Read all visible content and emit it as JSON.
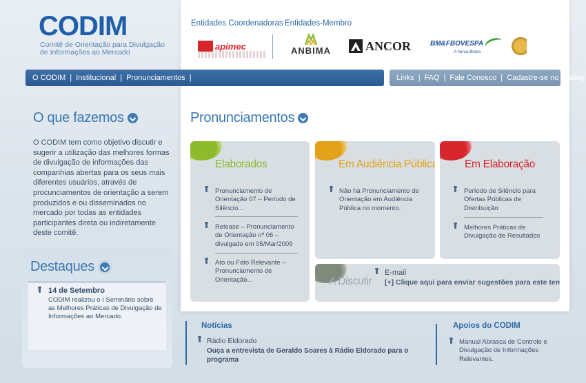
{
  "logo": {
    "word": "CODIM",
    "subtitle_line1": "Comitê de Orientação para Divulgação",
    "subtitle_line2": "de Informações ao Mercado"
  },
  "entities": {
    "coordinators_label": "Entidades Coordenadoras",
    "members_label": "Entidades-Membro",
    "apimec": "apimec",
    "anbima": "ANBIMA",
    "ancor": "ANCOR",
    "bovespa": "BM&FBOVESPA",
    "bovespa_tagline": "A Nova Bolsa"
  },
  "nav_main": [
    "O CODIM",
    "Institucional",
    "Pronunciamentos"
  ],
  "nav_secondary": [
    "Links",
    "FAQ",
    "Fale Conosco",
    "Cadastre-se no Mailing"
  ],
  "about": {
    "title": "O que fazemos",
    "text": "O CODIM tem como objetivo discutir e sugerir a utilização das melhores formas de divulgação de informações das companhias abertas para os seus mais diferentes usuários, através de procunciamentos de orientação a serem produzidos e ou disseminados no mercado por todas as entidades participantes direta ou indiretamente deste comitê."
  },
  "destaques": {
    "title": "Destaques",
    "date": "14 de Setembro",
    "text": "CODIM realizou o I Seminário sobre as Melhores Práticas de Divulgação de Informações ao Mercado."
  },
  "pronunciamentos": {
    "title": "Pronunciamentos",
    "elaborados": {
      "title": "Elaborados",
      "items": [
        "Pronunciamento de Orientação 07 – Período de Silêncio...",
        "Release – Pronunciamento de Orientação nº 06 – divulgado em 05/Mar/2009",
        "Ato ou Fato Relevante – Pronunciamento de Orientação..."
      ]
    },
    "audiencia": {
      "title": "Em Audiência Pública",
      "items": [
        "Não há Pronunciamento de Orientação em Audiência Pública no momento."
      ]
    },
    "elaboracao": {
      "title": "Em Elaboração",
      "items": [
        "Período de Silêncio para Ofertas Públicas de Distribuição",
        "Melhores Práticas de Divulgação de Resultados"
      ]
    },
    "discutir": {
      "title": "A Discutir",
      "email_label": "E-mail",
      "link": "[+] Clique aqui para enviar sugestões para este tema"
    }
  },
  "noticias": {
    "title": "Notícias",
    "source": "Rádio Eldorado",
    "headline": "Ouça a entrevista de Geraldo Soares à Rádio Eldorado para o programa"
  },
  "apoios": {
    "title": "Apoios do CODIM",
    "text": "Manual Abrasca de Controle e Divulgação de Informações Relevantes."
  },
  "colors": {
    "brand_blue": "#1f5ea8",
    "nav_blue": "#2b5b93",
    "nav_gray": "#7995b1",
    "green": "#8dbb2b",
    "orange": "#e3a21a",
    "red": "#d6262c",
    "gray_blob": "#8a9288"
  }
}
